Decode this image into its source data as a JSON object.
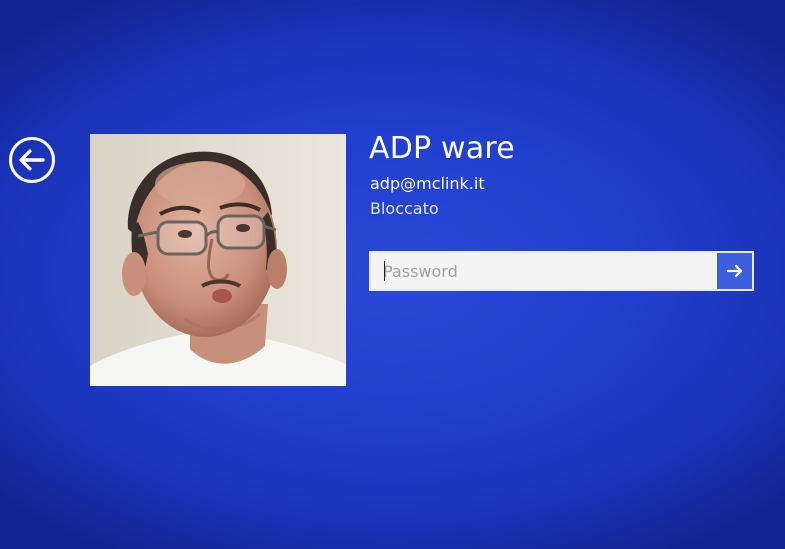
{
  "lock_screen": {
    "back_icon": "back-arrow-circle-icon",
    "user": {
      "name": "ADP ware",
      "email": "adp@mclink.it",
      "status": "Bloccato"
    },
    "password": {
      "placeholder": "Password",
      "value": "",
      "submit_icon": "arrow-right-icon"
    }
  },
  "colors": {
    "background": "#2240cf",
    "submit_button": "#3c5fe0",
    "text": "#ffffff"
  }
}
